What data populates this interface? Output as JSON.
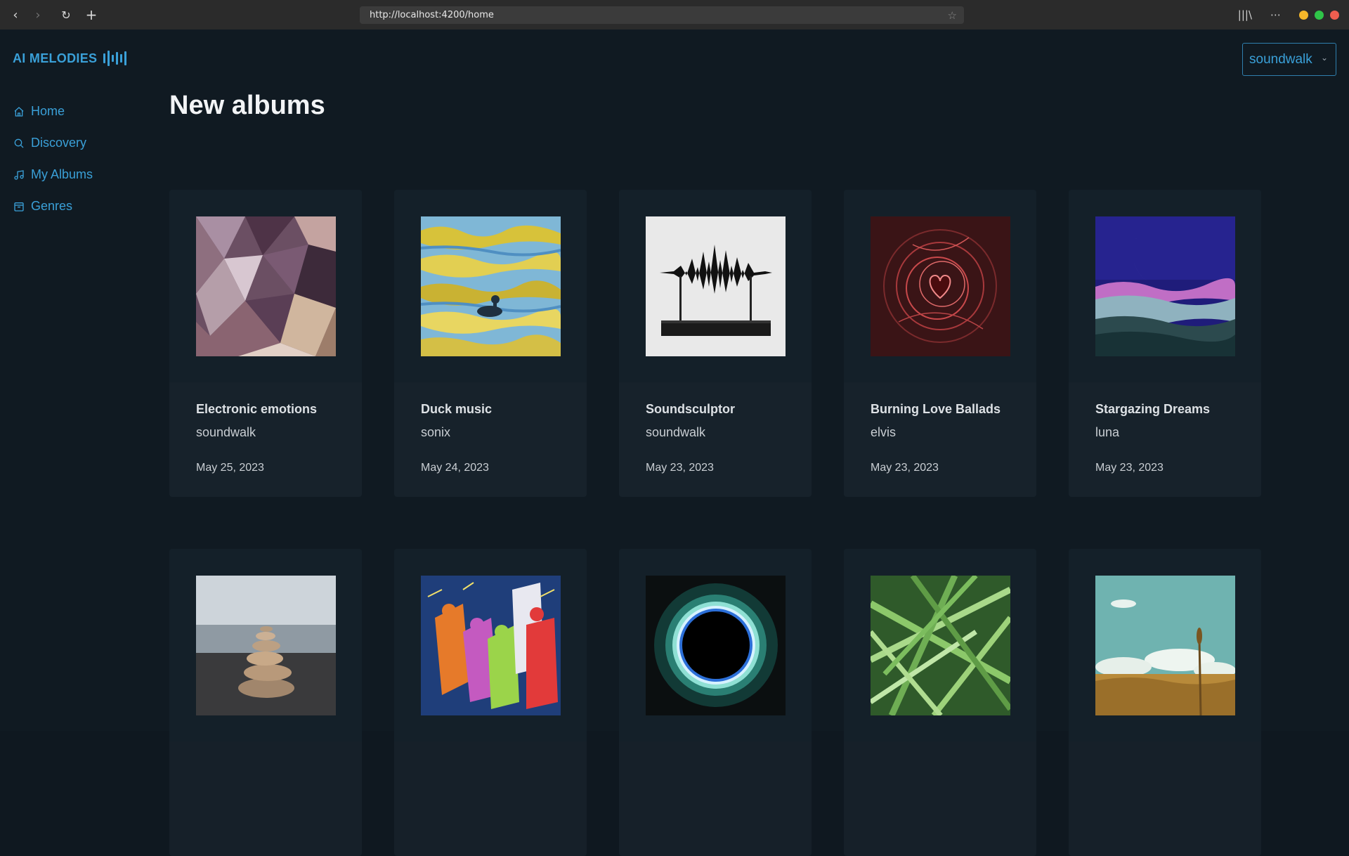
{
  "browser": {
    "url": "http://localhost:4200/home"
  },
  "app": {
    "logo_text": "AI MELODIES",
    "user_select": {
      "value": "soundwalk"
    },
    "sidebar": {
      "items": [
        {
          "label": "Home",
          "icon": "home-icon"
        },
        {
          "label": "Discovery",
          "icon": "search-icon"
        },
        {
          "label": "My Albums",
          "icon": "music-note-icon"
        },
        {
          "label": "Genres",
          "icon": "archive-icon"
        }
      ]
    },
    "page_title": "New albums",
    "accent_color": "#3aa0d8",
    "albums": [
      {
        "title": "Electronic emotions",
        "artist": "soundwalk",
        "date": "May 25, 2023",
        "art": "crystal-facets"
      },
      {
        "title": "Duck music",
        "artist": "sonix",
        "date": "May 24, 2023",
        "art": "duck-on-water"
      },
      {
        "title": "Soundsculptor",
        "artist": "soundwalk",
        "date": "May 23, 2023",
        "art": "waveform-sculpture"
      },
      {
        "title": "Burning Love Ballads",
        "artist": "elvis",
        "date": "May 23, 2023",
        "art": "red-heart-swirl"
      },
      {
        "title": "Stargazing Dreams",
        "artist": "luna",
        "date": "May 23, 2023",
        "art": "crescent-moon-waves"
      },
      {
        "title": "",
        "artist": "",
        "date": "",
        "art": "stacked-stones"
      },
      {
        "title": "",
        "artist": "",
        "date": "",
        "art": "dancing-musicians"
      },
      {
        "title": "",
        "artist": "",
        "date": "",
        "art": "black-hole-ring"
      },
      {
        "title": "",
        "artist": "",
        "date": "",
        "art": "green-grass"
      },
      {
        "title": "",
        "artist": "",
        "date": "",
        "art": "wheat-field-sky"
      }
    ]
  }
}
